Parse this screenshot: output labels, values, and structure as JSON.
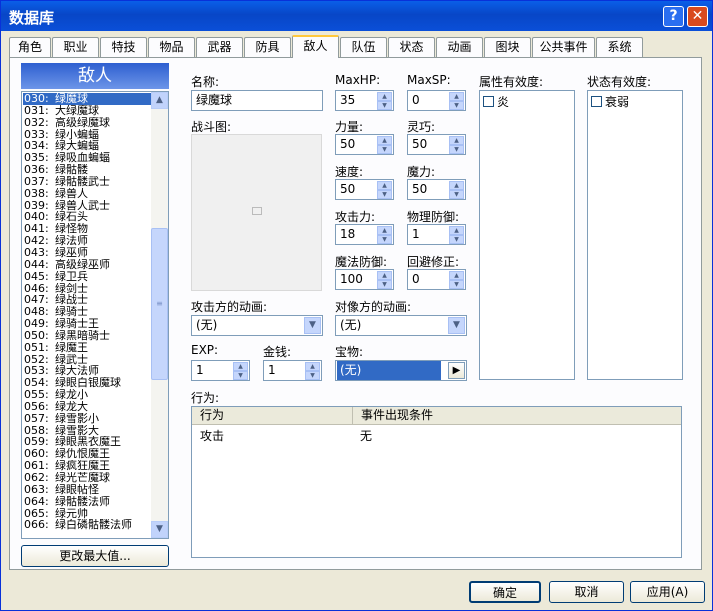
{
  "window": {
    "title": "数据库",
    "help": "?",
    "close": "✕"
  },
  "tabs": [
    "角色",
    "职业",
    "特技",
    "物品",
    "武器",
    "防具",
    "敌人",
    "队伍",
    "状态",
    "动画",
    "图块",
    "公共事件",
    "系统"
  ],
  "selected_tab": 6,
  "list_header": "敌人",
  "list": [
    [
      "030:",
      "绿魔球"
    ],
    [
      "031:",
      "大绿魔球"
    ],
    [
      "032:",
      "高级绿魔球"
    ],
    [
      "033:",
      "绿小蝙蝠"
    ],
    [
      "034:",
      "绿大蝙蝠"
    ],
    [
      "035:",
      "绿吸血蝙蝠"
    ],
    [
      "036:",
      "绿骷髅"
    ],
    [
      "037:",
      "绿骷髅武士"
    ],
    [
      "038:",
      "绿兽人"
    ],
    [
      "039:",
      "绿兽人武士"
    ],
    [
      "040:",
      "绿石头"
    ],
    [
      "041:",
      "绿怪物"
    ],
    [
      "042:",
      "绿法师"
    ],
    [
      "043:",
      "绿巫师"
    ],
    [
      "044:",
      "高级绿巫师"
    ],
    [
      "045:",
      "绿卫兵"
    ],
    [
      "046:",
      "绿剑士"
    ],
    [
      "047:",
      "绿战士"
    ],
    [
      "048:",
      "绿骑士"
    ],
    [
      "049:",
      "绿骑士王"
    ],
    [
      "050:",
      "绿黑暗骑士"
    ],
    [
      "051:",
      "绿魔王"
    ],
    [
      "052:",
      "绿武士"
    ],
    [
      "053:",
      "绿大法师"
    ],
    [
      "054:",
      "绿眼白银魔球"
    ],
    [
      "055:",
      "绿龙小"
    ],
    [
      "056:",
      "绿龙大"
    ],
    [
      "057:",
      "绿雪影小"
    ],
    [
      "058:",
      "绿雪影大"
    ],
    [
      "059:",
      "绿眼黑衣魔王"
    ],
    [
      "060:",
      "绿仇恨魔王"
    ],
    [
      "061:",
      "绿疯狂魔王"
    ],
    [
      "062:",
      "绿光芒魔球"
    ],
    [
      "063:",
      "绿眼帖怪"
    ],
    [
      "064:",
      "绿骷髅法师"
    ],
    [
      "065:",
      "绿元帅"
    ],
    [
      "066:",
      "绿白磷骷髅法师"
    ]
  ],
  "change_max_button": "更改最大值...",
  "form": {
    "name_label": "名称:",
    "name_value": "绿魔球",
    "battler_label": "战斗图:",
    "maxhp_label": "MaxHP:",
    "maxhp_value": "35",
    "maxsp_label": "MaxSP:",
    "maxsp_value": "0",
    "str_label": "力量:",
    "str_value": "50",
    "dex_label": "灵巧:",
    "dex_value": "50",
    "agi_label": "速度:",
    "agi_value": "50",
    "int_label": "魔力:",
    "int_value": "50",
    "atk_label": "攻击力:",
    "atk_value": "18",
    "pdef_label": "物理防御:",
    "pdef_value": "1",
    "mdef_label": "魔法防御:",
    "mdef_value": "100",
    "eva_label": "回避修正:",
    "eva_value": "0",
    "attack_anim_label": "攻击方的动画:",
    "attack_anim_value": "(无)",
    "target_anim_label": "对像方的动画:",
    "target_anim_value": "(无)",
    "exp_label": "EXP:",
    "exp_value": "1",
    "gold_label": "金钱:",
    "gold_value": "1",
    "treasure_label": "宝物:",
    "treasure_value": "(无)",
    "element_label": "属性有效度:",
    "element_items": [
      "炎"
    ],
    "state_label": "状态有效度:",
    "state_items": [
      "衰弱"
    ]
  },
  "actions": {
    "label": "行为:",
    "col1": "行为",
    "col2": "事件出现条件",
    "row_action": "攻击",
    "row_cond": "无"
  },
  "buttons": {
    "ok": "确定",
    "cancel": "取消",
    "apply": "应用(A)"
  }
}
